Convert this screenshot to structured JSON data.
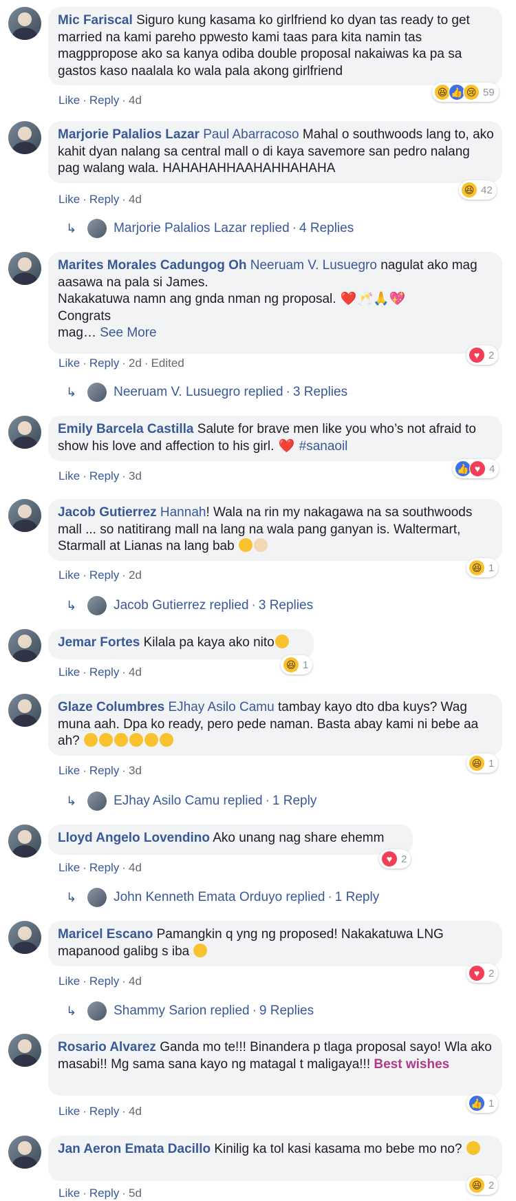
{
  "actions": {
    "like": "Like",
    "reply": "Reply",
    "sep": "·",
    "edited": "Edited"
  },
  "comments": [
    {
      "author": "Mic Fariscal",
      "mention": "",
      "text": "Siguro kung kasama ko girlfriend ko dyan tas ready to get married na kami pareho ppwesto kami taas para kita namin tas magppropose ako sa kanya odiba double proposal nakaiwas ka pa sa gastos kaso naalala ko wala pala akong girlfriend",
      "time": "4d",
      "reaction_count": "59"
    },
    {
      "author": "Marjorie Palalios Lazar",
      "mention": "Paul Abarracoso",
      "text": "Mahal o southwoods lang to, ako kahit dyan nalang sa central mall o di kaya savemore san pedro nalang pag walang wala. HAHAHAHHAAHAHHAHAHA",
      "time": "4d",
      "reaction_count": "42",
      "replies": {
        "name": "Marjorie Palalios Lazar replied",
        "count": "4 Replies"
      }
    },
    {
      "author": "Marites Morales Cadungog Oh",
      "mention": "Neeruam V. Lusuegro",
      "text": "nagulat ako mag aasawa na pala si James.",
      "text2": "Nakakatuwa namn ang gnda nman ng proposal.",
      "text3": "Congrats",
      "text4": "mag…",
      "see_more": "See More",
      "time": "2d",
      "reaction_count": "2",
      "replies": {
        "name": "Neeruam V. Lusuegro replied",
        "count": "3 Replies"
      }
    },
    {
      "author": "Emily Barcela Castilla",
      "mention": "",
      "text": "Salute for brave men like you who’s not afraid to show his love and affection to his girl.",
      "hashtag": "#sanaoil",
      "time": "3d",
      "reaction_count": "4"
    },
    {
      "author": "Jacob Gutierrez",
      "mention": "Hannah",
      "text": "! Wala na rin my nakagawa na sa southwoods mall ... so natitirang mall na lang na wala pang ganyan is. Waltermart, Starmall at Lianas na lang bab",
      "time": "2d",
      "reaction_count": "1",
      "replies": {
        "name": "Jacob Gutierrez replied",
        "count": "3 Replies"
      }
    },
    {
      "author": "Jemar Fortes",
      "mention": "",
      "text": "Kilala pa kaya ako nito",
      "time": "4d",
      "reaction_count": "1"
    },
    {
      "author": "Glaze Columbres",
      "mention": "EJhay Asilo Camu",
      "text": "tambay kayo dto dba kuys? Wag muna aah. Dpa ko ready, pero pede naman. Basta abay kami ni bebe aa ah?",
      "time": "3d",
      "reaction_count": "1",
      "replies": {
        "name": "EJhay Asilo Camu replied",
        "count": "1 Reply"
      }
    },
    {
      "author": "Lloyd Angelo Lovendino",
      "mention": "",
      "text": "Ako unang nag share ehemm",
      "time": "4d",
      "reaction_count": "2",
      "replies": {
        "name": "John Kenneth Emata Orduyo replied",
        "count": "1 Reply"
      }
    },
    {
      "author": "Maricel Escano",
      "mention": "",
      "text": "Pamangkin q yng ng proposed! Nakakatuwa LNG mapanood galibg s iba",
      "time": "4d",
      "reaction_count": "2",
      "replies": {
        "name": "Shammy Sarion replied",
        "count": "9 Replies"
      }
    },
    {
      "author": "Rosario Alvarez",
      "mention": "",
      "text": "Ganda mo te!!! Binandera p tlaga proposal sayo! Wla ako masabi!! Mg sama sana kayo ng matagal t maligaya!!!",
      "best_wishes": "Best wishes",
      "time": "4d",
      "reaction_count": "1"
    },
    {
      "author": "Jan Aeron Emata Dacillo",
      "mention": "",
      "text": "Kinilig ka tol kasi kasama mo bebe mo no?",
      "time": "5d",
      "reaction_count": "2"
    }
  ]
}
